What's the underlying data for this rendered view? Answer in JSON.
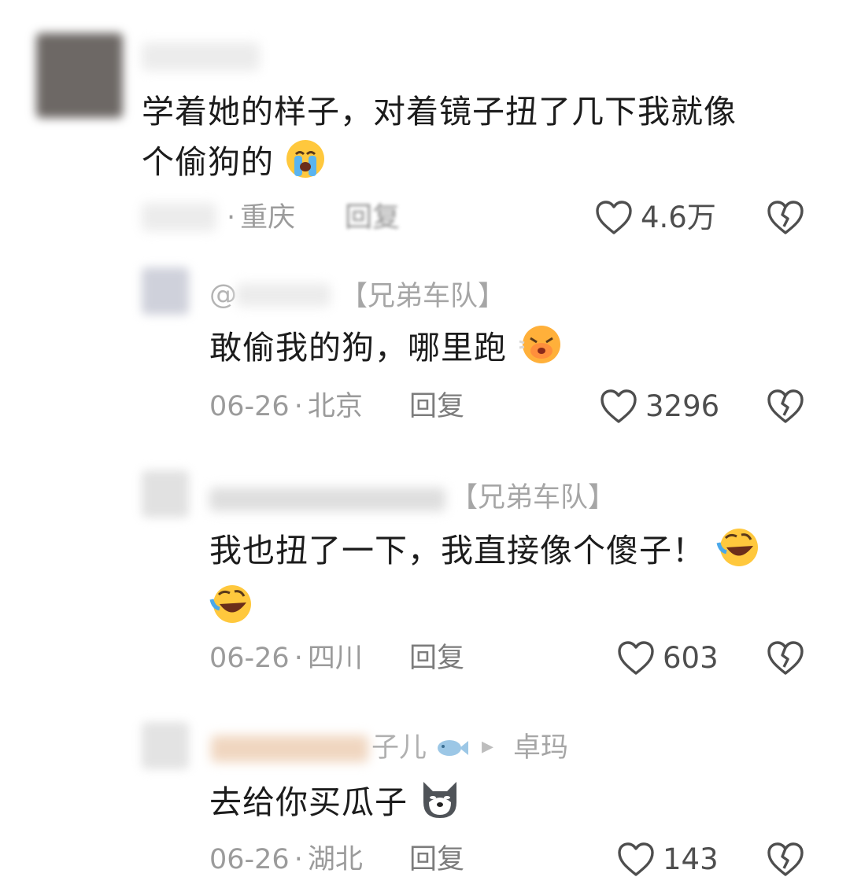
{
  "comments": [
    {
      "text_line1": "学着她的样子，对着镜子扭了几下我就像",
      "text_line2": "个偷狗的",
      "location_sep": "·",
      "location": "重庆",
      "reply_label": "回复",
      "likes": "4.6万",
      "emoji": "loudly-crying-face-icon"
    },
    {
      "at_prefix": "@",
      "tag": "【兄弟车队】",
      "text": "敢偷我的狗，哪里跑",
      "date": "06-26",
      "location_sep": "·",
      "location": "北京",
      "reply_label": "回复",
      "likes": "3296",
      "emoji": "angry-kiss-face-icon"
    },
    {
      "tag": "【兄弟车队】",
      "text_line1": "我也扭了一下，我直接像个傻子！",
      "date": "06-26",
      "location_sep": "·",
      "location": "四川",
      "reply_label": "回复",
      "likes": "603",
      "emoji": "rolling-laughing-face-icon"
    },
    {
      "name_suffix": "子儿",
      "reply_arrow": "▸",
      "reply_to": "卓玛",
      "text": "去给你买瓜子",
      "date": "06-26",
      "location_sep": "·",
      "location": "湖北",
      "reply_label": "回复",
      "likes": "143",
      "emoji": "husky-dog-face-icon"
    }
  ],
  "colors": {
    "text": "#1c1c1c",
    "meta": "#9b9b9b",
    "like": "#4e4e4e"
  }
}
